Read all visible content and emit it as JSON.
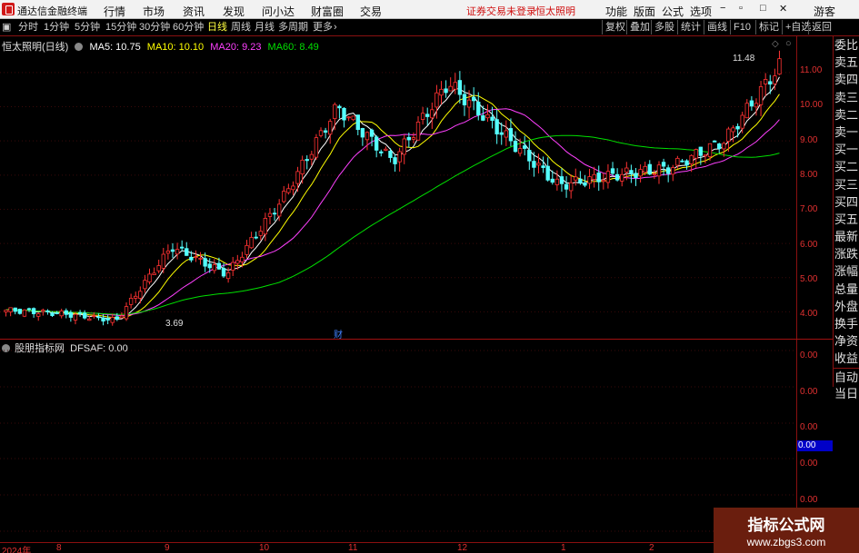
{
  "app": {
    "name": "通达信金融终端"
  },
  "menu": [
    "行情",
    "市场",
    "资讯",
    "发现",
    "问小达",
    "财富圈",
    "交易"
  ],
  "notice": "证券交易未登录",
  "stock_name": "恒太照明",
  "menu_right": [
    "功能",
    "版面",
    "公式",
    "选项"
  ],
  "guest": "游客",
  "periods": [
    "分时",
    "1分钟",
    "5分钟",
    "15分钟",
    "30分钟",
    "60分钟",
    "日线",
    "周线",
    "月线",
    "多周期",
    "更多"
  ],
  "active_period": "日线",
  "tools": [
    "复权",
    "叠加",
    "多股",
    "统计",
    "画线",
    "F10",
    "标记",
    "+自选",
    "返回"
  ],
  "legend": {
    "title": "恒太照明(日线)",
    "ma5": "MA5: 10.75",
    "ma10": "MA10: 10.10",
    "ma20": "MA20: 9.23",
    "ma60": "MA60: 8.49"
  },
  "annotations": {
    "high": "11.48",
    "low": "3.69",
    "event": "财"
  },
  "indicator": {
    "name": "股朋指标网",
    "value": "DFSAF: 0.00"
  },
  "right_panel": [
    "委比",
    "卖五",
    "卖四",
    "卖三",
    "卖二",
    "卖一",
    "买一",
    "买二",
    "买三",
    "买四",
    "买五",
    "最新",
    "涨跌",
    "涨幅",
    "总量",
    "外盘",
    "换手",
    "净资",
    "收益",
    "自动",
    "当日"
  ],
  "yaxis": [
    "11.00",
    "10.00",
    "9.00",
    "8.00",
    "7.00",
    "6.00",
    "5.00",
    "4.00"
  ],
  "ind_axis": [
    "0.00",
    "0.00",
    "0.00",
    "0.00",
    "0.00",
    "0.00"
  ],
  "ind_current": "0.00",
  "dates": [
    "2024年",
    "8",
    "9",
    "10",
    "11",
    "12",
    "1",
    "2"
  ],
  "watermark": {
    "line1": "指标公式网",
    "line2": "www.zbgs3.com"
  },
  "colors": {
    "up": "#ff3232",
    "down": "#54ffff",
    "ma5": "#ffffff",
    "ma10": "#ffff00",
    "ma20": "#ff40ff",
    "ma60": "#00e000"
  },
  "chart_data": {
    "type": "candlestick",
    "title": "恒太照明(日线)",
    "ylim": [
      3.4,
      11.9
    ],
    "x_labels": [
      "2024年",
      "8",
      "9",
      "10",
      "11",
      "12",
      "1",
      "2"
    ],
    "ohlc_keypoints": [
      {
        "date": "2024-07",
        "close": 4.05
      },
      {
        "date": "2024-08",
        "close": 3.95
      },
      {
        "date": "2024-09",
        "close": 3.75
      },
      {
        "date": "2024-10-08",
        "close": 5.9
      },
      {
        "date": "2024-10-18",
        "close": 5.1
      },
      {
        "date": "2024-11-05",
        "close": 7.3
      },
      {
        "date": "2024-11-12",
        "close": 10.0
      },
      {
        "date": "2024-11-20",
        "close": 8.4
      },
      {
        "date": "2024-12-05",
        "close": 10.7
      },
      {
        "date": "2024-12-20",
        "close": 9.2
      },
      {
        "date": "2025-01-02",
        "close": 7.7
      },
      {
        "date": "2025-01-20",
        "close": 8.0
      },
      {
        "date": "2025-02-10",
        "close": 8.2
      },
      {
        "date": "2025-02-20",
        "close": 9.0
      },
      {
        "date": "2025-02-28",
        "close": 11.2
      }
    ],
    "high_label": 11.48,
    "low_label": 3.69,
    "ma": {
      "MA5": 10.75,
      "MA10": 10.1,
      "MA20": 9.23,
      "MA60": 8.49
    }
  }
}
